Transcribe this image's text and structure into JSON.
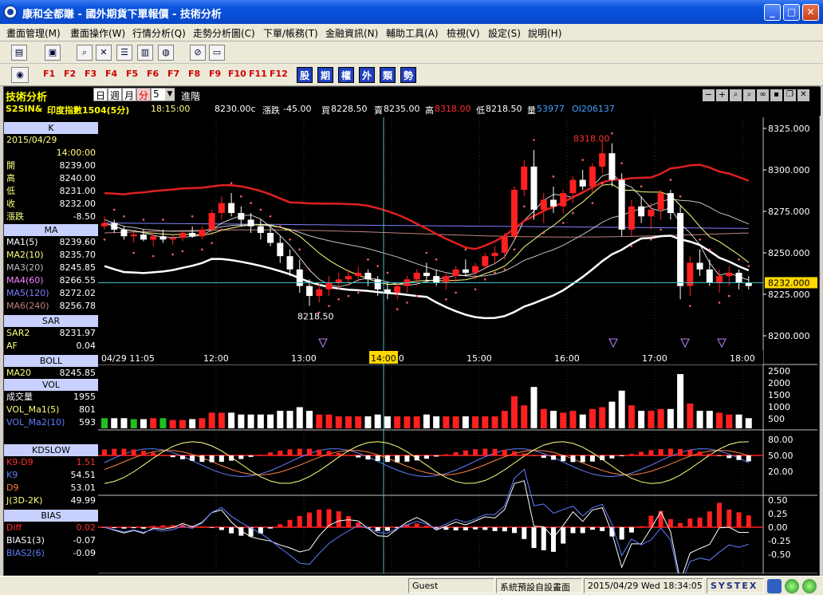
{
  "window": {
    "title": "康和全都賺 - 國外期貨下單報價 - 技術分析",
    "controls": [
      "_",
      "□",
      "✕"
    ]
  },
  "menu": [
    "畫面管理(M)",
    "畫面操作(W)",
    "行情分析(Q)",
    "走勢分析圖(C)",
    "下單/帳務(T)",
    "金融資訊(N)",
    "輔助工具(A)",
    "檢視(V)",
    "設定(S)",
    "說明(H)"
  ],
  "fkeys": [
    "F1",
    "F2",
    "F3",
    "F4",
    "F5",
    "F6",
    "F7",
    "F8",
    "F9",
    "F10",
    "F11",
    "F12"
  ],
  "cat_keys": [
    "股",
    "期",
    "權",
    "外",
    "類",
    "勢"
  ],
  "panel": {
    "title": "技術分析",
    "periods": [
      "日",
      "週",
      "月",
      "分"
    ],
    "interval": "5",
    "advanced": "進階"
  },
  "quote": {
    "symbol": "S2SIN&",
    "name": "印度指數1504(5分)",
    "time": "18:15:00",
    "last": "8230.00c",
    "change_label": "漲跌",
    "change": "-45.00",
    "bid_label": "買",
    "bid": "8228.50",
    "ask_label": "賣",
    "ask": "8235.00",
    "high_label": "高",
    "high": "8318.00",
    "low_label": "低",
    "low": "8218.50",
    "vol_label": "量",
    "vol": "53977",
    "oi": "OI206137"
  },
  "k_panel": {
    "title": "K",
    "date": "2015/04/29",
    "time": "14:00:00",
    "rows": [
      {
        "k": "開",
        "v": "8239.00"
      },
      {
        "k": "高",
        "v": "8240.00"
      },
      {
        "k": "低",
        "v": "8231.00"
      },
      {
        "k": "收",
        "v": "8232.00"
      },
      {
        "k": "漲跌",
        "v": "-8.50"
      }
    ]
  },
  "ma_panel": {
    "title": "MA",
    "rows": [
      {
        "k": "MA1(5)",
        "v": "8239.60",
        "color": "#ffffff"
      },
      {
        "k": "MA2(10)",
        "v": "8235.70",
        "color": "#ffff80"
      },
      {
        "k": "MA3(20)",
        "v": "8245.85",
        "color": "#c0c0c0"
      },
      {
        "k": "MA4(60)",
        "v": "8266.55",
        "color": "#ff80ff"
      },
      {
        "k": "MA5(120)",
        "v": "8272.02",
        "color": "#8080ff"
      },
      {
        "k": "MA6(240)",
        "v": "8256.78",
        "color": "#c08080"
      }
    ]
  },
  "sar_panel": {
    "title": "SAR",
    "rows": [
      {
        "k": "SAR2",
        "v": "8231.97"
      },
      {
        "k": "AF",
        "v": "0.04"
      }
    ]
  },
  "boll_panel": {
    "title": "BOLL",
    "rows": [
      {
        "k": "MA20",
        "v": "8245.85"
      }
    ]
  },
  "vol_panel": {
    "title": "VOL",
    "rows": [
      {
        "k": "成交量",
        "v": "1955",
        "color": "#ffffff"
      },
      {
        "k": "VOL_Ma1(5)",
        "v": "801",
        "color": "#ffff80"
      },
      {
        "k": "VOL_Ma2(10)",
        "v": "593",
        "color": "#6080ff"
      }
    ]
  },
  "kd_panel": {
    "title": "KDSLOW",
    "rows": [
      {
        "k": "K9-D9",
        "v": "1.51",
        "color": "#ff3030"
      },
      {
        "k": "K9",
        "v": "54.51",
        "color": "#6080ff"
      },
      {
        "k": "D9",
        "v": "53.01",
        "color": "#ff8040"
      },
      {
        "k": "J(3D-2K)",
        "v": "49.99",
        "color": "#ffff80"
      }
    ]
  },
  "bias_panel": {
    "title": "BIAS",
    "rows": [
      {
        "k": "Diff",
        "v": "0.02",
        "color": "#ff3030"
      },
      {
        "k": "BIAS1(3)",
        "v": "-0.07",
        "color": "#ffffff"
      },
      {
        "k": "BIAS2(6)",
        "v": "-0.09",
        "color": "#6080ff"
      }
    ]
  },
  "chart_data": {
    "type": "candlestick",
    "x_labels": [
      "04/29 11:05",
      "12:00",
      "13:00",
      "14:00",
      "15:00",
      "16:00",
      "17:00",
      "18:00"
    ],
    "price_axis": [
      "8325.000",
      "8300.000",
      "8275.000",
      "8250.000",
      "8225.000",
      "8200.000"
    ],
    "price_range": [
      8200,
      8325
    ],
    "current_price_tag": "8232.000",
    "annotations": [
      "8318.00",
      "8218.50"
    ],
    "vol_axis": [
      "2500",
      "2000",
      "1500",
      "1000",
      "500"
    ],
    "kd_axis": [
      "80.00",
      "50.00",
      "20.00"
    ],
    "bias_axis": [
      "0.50",
      "0.25",
      "0.00",
      "-0.25",
      "-0.50"
    ],
    "candles": [
      [
        8266,
        8272,
        8264,
        8268
      ],
      [
        8268,
        8270,
        8262,
        8264
      ],
      [
        8264,
        8266,
        8258,
        8260
      ],
      [
        8260,
        8263,
        8256,
        8261
      ],
      [
        8261,
        8264,
        8257,
        8258
      ],
      [
        8258,
        8262,
        8254,
        8260
      ],
      [
        8260,
        8264,
        8256,
        8258
      ],
      [
        8258,
        8261,
        8255,
        8259
      ],
      [
        8259,
        8263,
        8257,
        8262
      ],
      [
        8262,
        8266,
        8259,
        8260
      ],
      [
        8260,
        8266,
        8258,
        8264
      ],
      [
        8264,
        8276,
        8262,
        8274
      ],
      [
        8274,
        8284,
        8270,
        8280
      ],
      [
        8280,
        8286,
        8272,
        8274
      ],
      [
        8274,
        8278,
        8266,
        8270
      ],
      [
        8270,
        8274,
        8262,
        8266
      ],
      [
        8266,
        8270,
        8258,
        8262
      ],
      [
        8262,
        8266,
        8254,
        8256
      ],
      [
        8256,
        8260,
        8244,
        8248
      ],
      [
        8248,
        8252,
        8236,
        8240
      ],
      [
        8240,
        8246,
        8226,
        8230
      ],
      [
        8230,
        8234,
        8218,
        8224
      ],
      [
        8224,
        8232,
        8220,
        8228
      ],
      [
        8228,
        8236,
        8224,
        8232
      ],
      [
        8232,
        8238,
        8228,
        8234
      ],
      [
        8234,
        8240,
        8230,
        8236
      ],
      [
        8236,
        8242,
        8232,
        8238
      ],
      [
        8238,
        8240,
        8230,
        8234
      ],
      [
        8234,
        8236,
        8224,
        8228
      ],
      [
        8228,
        8232,
        8222,
        8226
      ],
      [
        8226,
        8232,
        8222,
        8230
      ],
      [
        8230,
        8236,
        8226,
        8234
      ],
      [
        8234,
        8240,
        8230,
        8238
      ],
      [
        8238,
        8244,
        8232,
        8236
      ],
      [
        8236,
        8240,
        8230,
        8232
      ],
      [
        8232,
        8238,
        8228,
        8236
      ],
      [
        8236,
        8242,
        8232,
        8240
      ],
      [
        8240,
        8246,
        8236,
        8238
      ],
      [
        8238,
        8244,
        8234,
        8242
      ],
      [
        8242,
        8250,
        8240,
        8248
      ],
      [
        8248,
        8254,
        8244,
        8250
      ],
      [
        8250,
        8262,
        8246,
        8260
      ],
      [
        8260,
        8290,
        8258,
        8288
      ],
      [
        8288,
        8306,
        8284,
        8302
      ],
      [
        8302,
        8312,
        8270,
        8276
      ],
      [
        8276,
        8286,
        8268,
        8282
      ],
      [
        8282,
        8290,
        8274,
        8278
      ],
      [
        8278,
        8288,
        8274,
        8286
      ],
      [
        8286,
        8296,
        8280,
        8294
      ],
      [
        8294,
        8300,
        8288,
        8290
      ],
      [
        8290,
        8304,
        8286,
        8302
      ],
      [
        8302,
        8318,
        8298,
        8310
      ],
      [
        8310,
        8316,
        8290,
        8294
      ],
      [
        8294,
        8298,
        8260,
        8264
      ],
      [
        8264,
        8282,
        8260,
        8278
      ],
      [
        8278,
        8284,
        8268,
        8272
      ],
      [
        8272,
        8280,
        8264,
        8276
      ],
      [
        8276,
        8288,
        8270,
        8286
      ],
      [
        8286,
        8288,
        8270,
        8274
      ],
      [
        8274,
        8278,
        8222,
        8230
      ],
      [
        8230,
        8248,
        8224,
        8244
      ],
      [
        8244,
        8252,
        8236,
        8240
      ],
      [
        8240,
        8246,
        8230,
        8232
      ],
      [
        8232,
        8240,
        8226,
        8236
      ],
      [
        8236,
        8242,
        8230,
        8238
      ],
      [
        8238,
        8240,
        8228,
        8232
      ],
      [
        8232,
        8236,
        8228,
        8230
      ]
    ]
  }
}
